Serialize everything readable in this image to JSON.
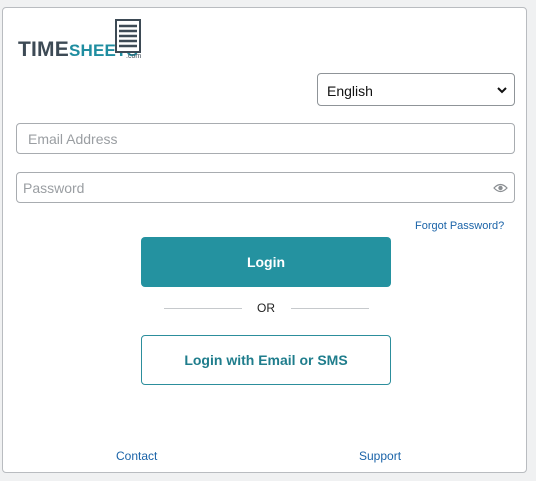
{
  "brand": {
    "logo_part1": "TIME",
    "logo_part2": "SHEETS",
    "logo_suffix": ".com",
    "icon": "timesheet-ledger-icon",
    "colors": {
      "dark": "#3d4a55",
      "accent": "#1f8da0"
    }
  },
  "language_select": {
    "selected": "English",
    "icon": "chevron-down-icon"
  },
  "email_field": {
    "placeholder": "Email Address",
    "value": ""
  },
  "password_field": {
    "placeholder": "Password",
    "value": "",
    "icon": "eye-icon"
  },
  "forgot_password_label": "Forgot Password?",
  "login_label": "Login",
  "divider_label": "OR",
  "alt_login_label": "Login with Email or SMS",
  "footer": {
    "contact_label": "Contact",
    "support_label": "Support"
  },
  "colors": {
    "primary": "#2492a0",
    "link": "#1a63a8",
    "background": "#f0f1f2"
  }
}
